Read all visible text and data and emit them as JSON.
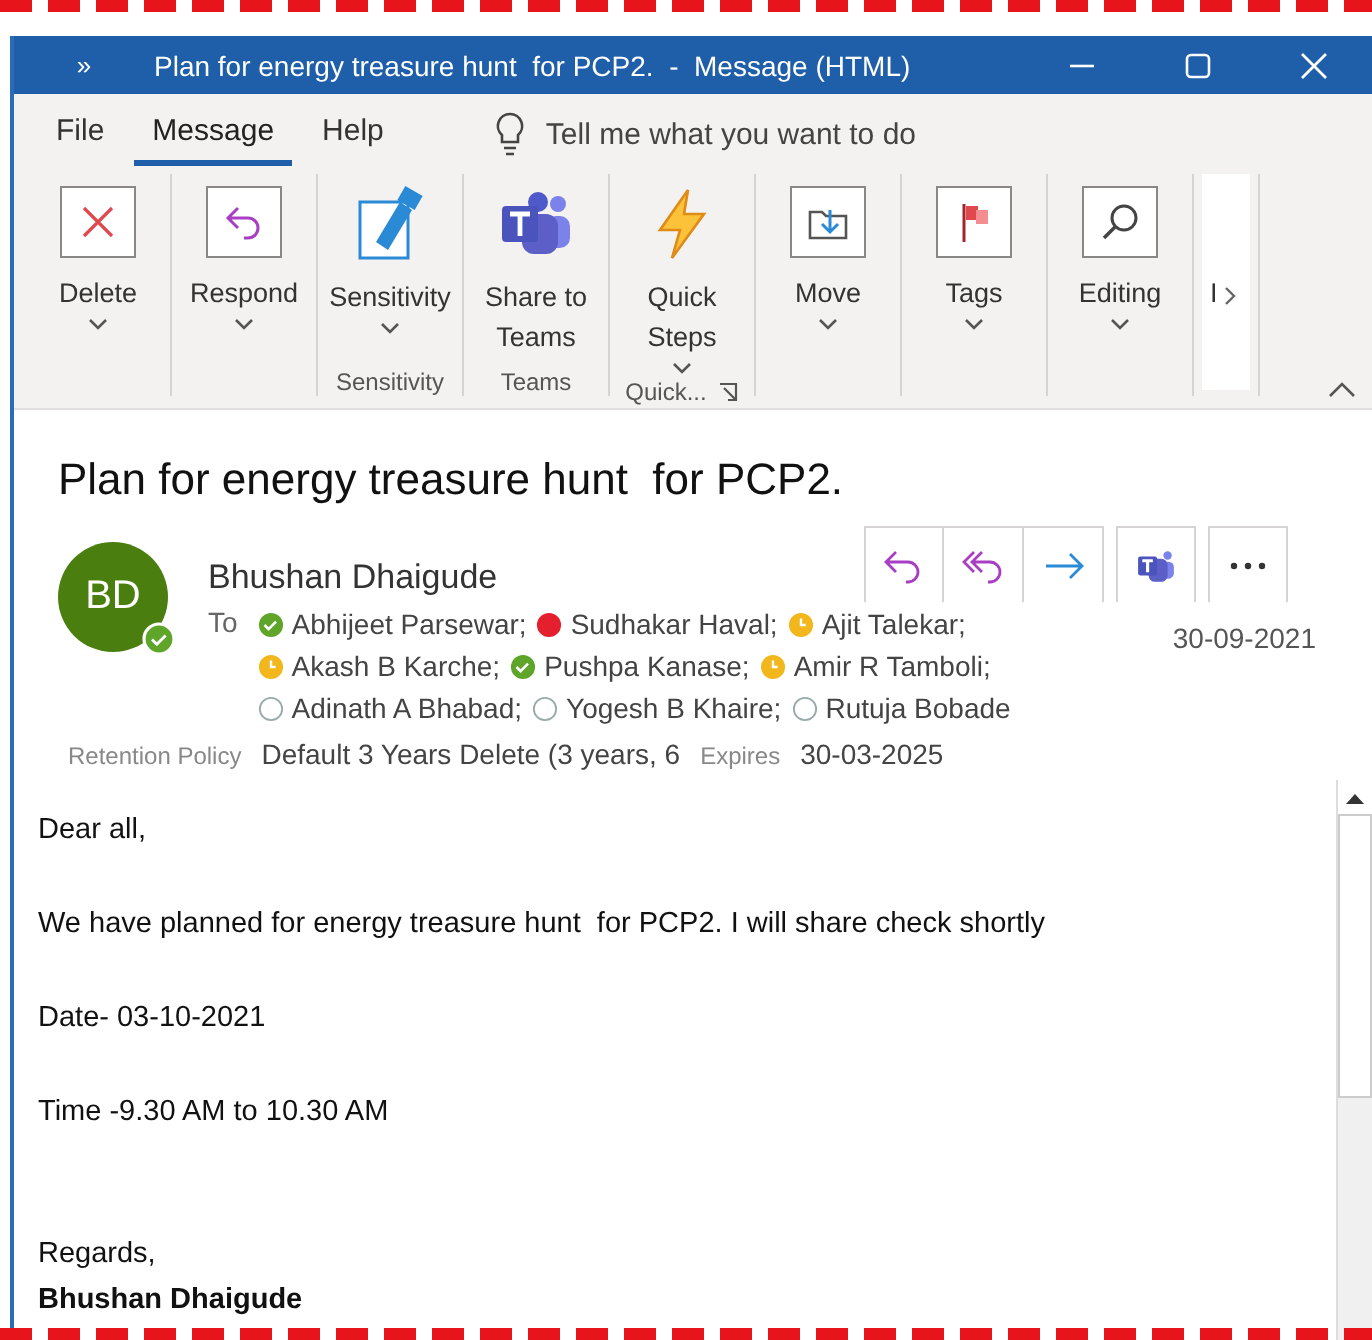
{
  "window": {
    "title": "Plan for energy treasure hunt  for PCP2.  -  Message (HTML)",
    "quick_access": "»"
  },
  "menu_tabs": [
    {
      "label": "File",
      "selected": false
    },
    {
      "label": "Message",
      "selected": true
    },
    {
      "label": "Help",
      "selected": false
    }
  ],
  "tell_me": {
    "placeholder": "Tell me what you want to do"
  },
  "ribbon": {
    "groups": [
      {
        "buttons": [
          {
            "kind": "delete",
            "label": "Delete",
            "dropdown": true
          }
        ]
      },
      {
        "buttons": [
          {
            "kind": "respond",
            "label": "Respond",
            "dropdown": true
          }
        ]
      },
      {
        "label": "Sensitivity",
        "buttons": [
          {
            "kind": "sensitivity",
            "label": "Sensitivity",
            "dropdown": true
          }
        ]
      },
      {
        "label": "Teams",
        "buttons": [
          {
            "kind": "teams",
            "label": "Share to Teams",
            "dropdown": false
          }
        ]
      },
      {
        "label": "Quick...",
        "launcher": true,
        "buttons": [
          {
            "kind": "quick",
            "label": "Quick Steps",
            "dropdown": true
          }
        ]
      },
      {
        "buttons": [
          {
            "kind": "move",
            "label": "Move",
            "dropdown": true
          }
        ]
      },
      {
        "buttons": [
          {
            "kind": "tags",
            "label": "Tags",
            "dropdown": true
          }
        ]
      },
      {
        "buttons": [
          {
            "kind": "editing",
            "label": "Editing",
            "dropdown": true
          }
        ]
      },
      {
        "buttons": [
          {
            "kind": "cut",
            "label": "I",
            "dropdown": false
          }
        ]
      }
    ]
  },
  "message": {
    "subject": "Plan for energy treasure hunt  for PCP2.",
    "avatar_initials": "BD",
    "sender": "Bhushan Dhaigude",
    "to_label": "To",
    "recipients": [
      {
        "name": "Abhijeet Parsewar;",
        "kind": "available"
      },
      {
        "name": "Sudhakar Haval;",
        "kind": "busy"
      },
      {
        "name": "Ajit Talekar;",
        "kind": "away"
      },
      {
        "name": "Akash B Karche;",
        "kind": "away"
      },
      {
        "name": "Pushpa Kanase;",
        "kind": "available"
      },
      {
        "name": "Amir R Tamboli;",
        "kind": "away"
      },
      {
        "name": "Adinath A Bhabad;",
        "kind": "offline"
      },
      {
        "name": "Yogesh B Khaire;",
        "kind": "offline"
      },
      {
        "name": "Rutuja Bobade",
        "kind": "offline"
      }
    ],
    "date": "30-09-2021",
    "retention_label": "Retention Policy",
    "retention_value": "Default 3 Years Delete (3 years, 6",
    "expires_label": "Expires",
    "expires_value": "30-03-2025"
  },
  "body": [
    {
      "kind": "text",
      "text": "Dear all,"
    },
    {
      "kind": "blank"
    },
    {
      "kind": "text",
      "text": "We have planned for energy treasure hunt  for PCP2. I will share check shortly"
    },
    {
      "kind": "blank"
    },
    {
      "kind": "text",
      "text": "Date- 03-10-2021"
    },
    {
      "kind": "blank"
    },
    {
      "kind": "text",
      "text": "Time -9.30 AM to 10.30 AM"
    },
    {
      "kind": "blank"
    },
    {
      "kind": "blank"
    },
    {
      "kind": "text",
      "text": "Regards,"
    },
    {
      "kind": "bold",
      "text": "Bhushan Dhaigude"
    }
  ]
}
